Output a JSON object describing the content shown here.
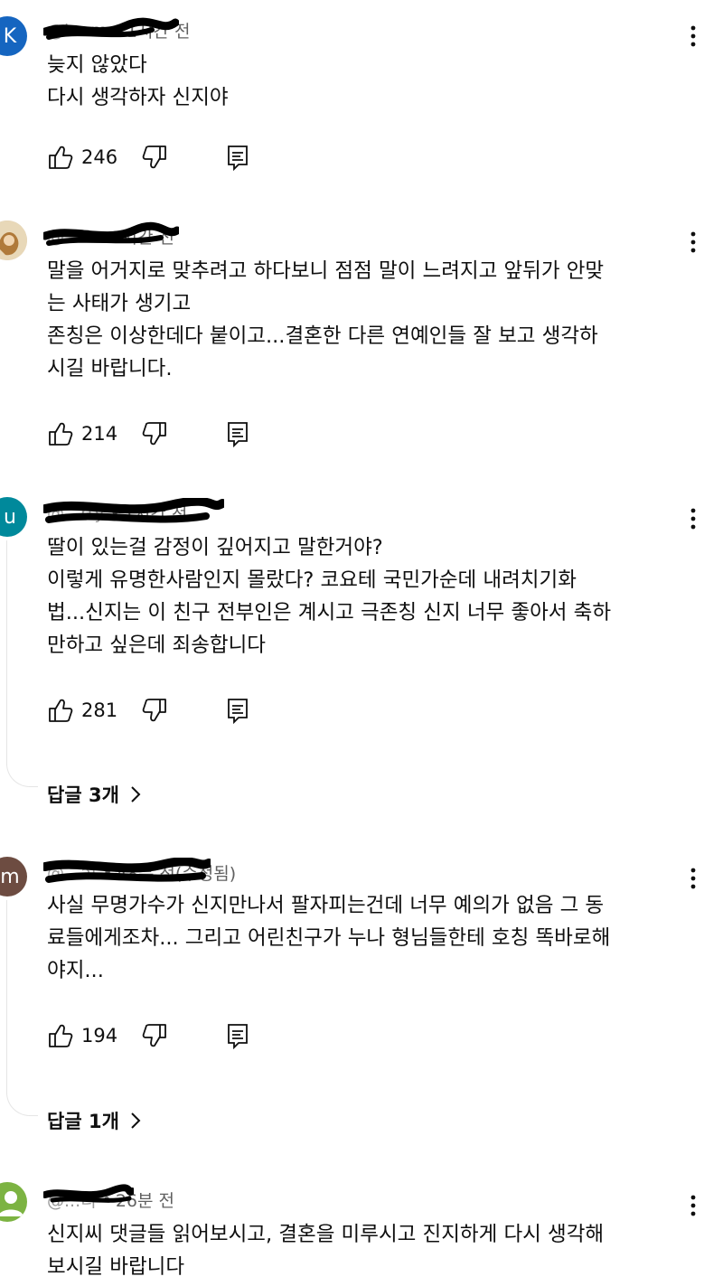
{
  "comments": [
    {
      "avatar_letter": "K",
      "avatar_color": "#1565c0",
      "handle": "@k...m",
      "time": "1시간 전",
      "text": "늦지 않았다\n다시 생각하자 신지야",
      "likes": "246",
      "replies_label": ""
    },
    {
      "avatar_letter": "",
      "avatar_color": "#d9c3a0",
      "handle": "@...5",
      "time": "1시간 전",
      "text": "말을 어거지로 맞추려고 하다보니 점점 말이 느려지고 앞뒤가 안맞\n는 사태가 생기고\n존칭은 이상한데다 붙이고...결혼한 다른 연예인들 잘 보고 생각하\n시길 바랍니다.",
      "likes": "214",
      "replies_label": ""
    },
    {
      "avatar_letter": "u",
      "avatar_color": "#00899b",
      "handle": "@...rty",
      "time": "1시간 전",
      "text": "딸이 있는걸 감정이 깊어지고 말한거야?\n이렇게 유명한사람인지 몰랐다? 코요테 국민가순데 내려치기화\n법...신지는 이 친구 전부인은 계시고 극존칭 신지 너무 좋아서 축하\n만하고 싶은데 죄송합니다",
      "likes": "281",
      "replies_label": "답글 3개"
    },
    {
      "avatar_letter": "m",
      "avatar_color": "#6d4c41",
      "handle": "@...af",
      "time": "48분 전(수정됨)",
      "text": "사실 무명가수가 신지만나서 팔자피는건데 너무 예의가 없음 그 동\n료들에게조차... 그리고 어린친구가 누나 형님들한테 호칭 똑바로해\n야지...",
      "likes": "194",
      "replies_label": "답글 1개"
    },
    {
      "avatar_letter": "",
      "avatar_color": "#7cb342",
      "handle": "@...티",
      "time": "26분 전",
      "text": "신지씨 댓글들 읽어보시고, 결혼을 미루시고 진지하게 다시 생각해\n보시길 바랍니다",
      "likes": "",
      "replies_label": ""
    }
  ]
}
